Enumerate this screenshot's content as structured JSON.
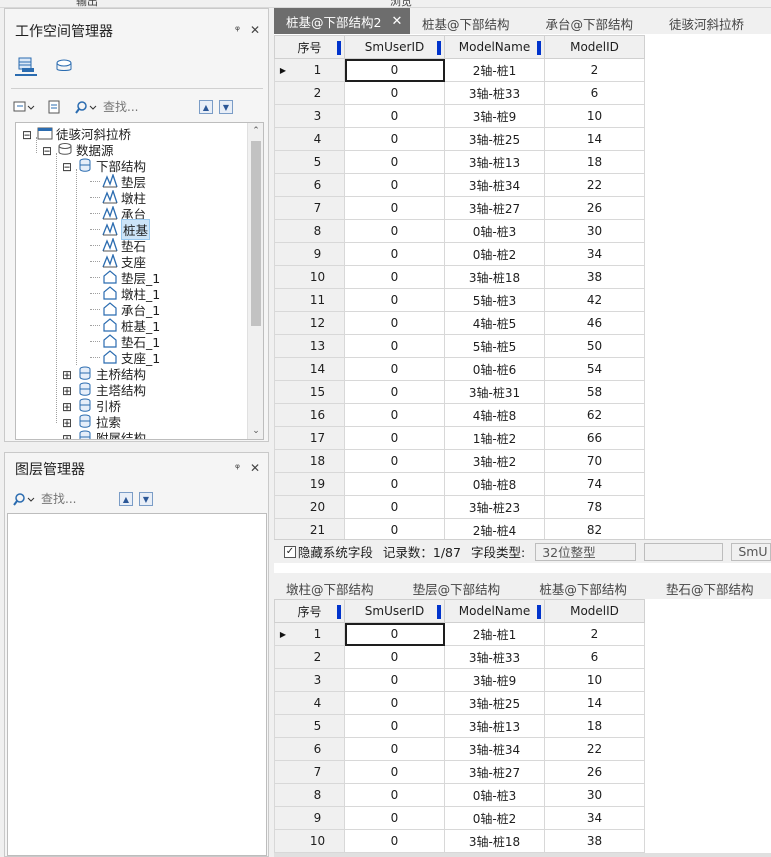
{
  "top": {
    "left_label": "输出",
    "mid_label": "浏览"
  },
  "workspace_panel": {
    "title": "工作空间管理器",
    "pin": "ᵠ",
    "close": "✕",
    "search_placeholder": "查找...",
    "tree": [
      {
        "label": "徒骇河斜拉桥",
        "level": 0,
        "expander": "⊟",
        "icon": "workspace"
      },
      {
        "label": "数据源",
        "level": 1,
        "expander": "⊟",
        "icon": "datasources"
      },
      {
        "label": "下部结构",
        "level": 2,
        "expander": "⊟",
        "icon": "datasource"
      },
      {
        "label": "垫层",
        "level": 3,
        "icon": "model"
      },
      {
        "label": "墩柱",
        "level": 3,
        "icon": "model"
      },
      {
        "label": "承台",
        "level": 3,
        "icon": "model"
      },
      {
        "label": "桩基",
        "level": 3,
        "icon": "model",
        "selected": true
      },
      {
        "label": "垫石",
        "level": 3,
        "icon": "model"
      },
      {
        "label": "支座",
        "level": 3,
        "icon": "model"
      },
      {
        "label": "垫层_1",
        "level": 3,
        "icon": "region"
      },
      {
        "label": "墩柱_1",
        "level": 3,
        "icon": "region"
      },
      {
        "label": "承台_1",
        "level": 3,
        "icon": "region"
      },
      {
        "label": "桩基_1",
        "level": 3,
        "icon": "region"
      },
      {
        "label": "垫石_1",
        "level": 3,
        "icon": "region"
      },
      {
        "label": "支座_1",
        "level": 3,
        "icon": "region"
      },
      {
        "label": "主桥结构",
        "level": 2,
        "expander": "⊞",
        "icon": "datasource"
      },
      {
        "label": "主塔结构",
        "level": 2,
        "expander": "⊞",
        "icon": "datasource"
      },
      {
        "label": "引桥",
        "level": 2,
        "expander": "⊞",
        "icon": "datasource"
      },
      {
        "label": "拉索",
        "level": 2,
        "expander": "⊞",
        "icon": "datasource"
      },
      {
        "label": "附属结构",
        "level": 2,
        "expander": "⊞",
        "icon": "datasource"
      }
    ]
  },
  "layer_panel": {
    "title": "图层管理器",
    "pin": "ᵠ",
    "close": "✕",
    "search_placeholder": "查找..."
  },
  "top_tabs": [
    {
      "label": "桩基@下部结构2",
      "active": true,
      "close": "✕"
    },
    {
      "label": "桩基@下部结构"
    },
    {
      "label": "承台@下部结构"
    },
    {
      "label": "徒骇河斜拉桥"
    }
  ],
  "bottom_tabs": [
    {
      "label": "墩柱@下部结构"
    },
    {
      "label": "垫层@下部结构"
    },
    {
      "label": "桩基@下部结构"
    },
    {
      "label": "垫石@下部结构"
    }
  ],
  "columns": [
    "序号",
    "SmUserID",
    "ModelName",
    "ModelID"
  ],
  "top_rows": [
    [
      "1",
      "0",
      "2轴-桩1",
      "2"
    ],
    [
      "2",
      "0",
      "3轴-桩33",
      "6"
    ],
    [
      "3",
      "0",
      "3轴-桩9",
      "10"
    ],
    [
      "4",
      "0",
      "3轴-桩25",
      "14"
    ],
    [
      "5",
      "0",
      "3轴-桩13",
      "18"
    ],
    [
      "6",
      "0",
      "3轴-桩34",
      "22"
    ],
    [
      "7",
      "0",
      "3轴-桩27",
      "26"
    ],
    [
      "8",
      "0",
      "0轴-桩3",
      "30"
    ],
    [
      "9",
      "0",
      "0轴-桩2",
      "34"
    ],
    [
      "10",
      "0",
      "3轴-桩18",
      "38"
    ],
    [
      "11",
      "0",
      "5轴-桩3",
      "42"
    ],
    [
      "12",
      "0",
      "4轴-桩5",
      "46"
    ],
    [
      "13",
      "0",
      "5轴-桩5",
      "50"
    ],
    [
      "14",
      "0",
      "0轴-桩6",
      "54"
    ],
    [
      "15",
      "0",
      "3轴-桩31",
      "58"
    ],
    [
      "16",
      "0",
      "4轴-桩8",
      "62"
    ],
    [
      "17",
      "0",
      "1轴-桩2",
      "66"
    ],
    [
      "18",
      "0",
      "3轴-桩2",
      "70"
    ],
    [
      "19",
      "0",
      "0轴-桩8",
      "74"
    ],
    [
      "20",
      "0",
      "3轴-桩23",
      "78"
    ],
    [
      "21",
      "0",
      "2轴-桩4",
      "82"
    ]
  ],
  "bottom_rows": [
    [
      "1",
      "0",
      "2轴-桩1",
      "2"
    ],
    [
      "2",
      "0",
      "3轴-桩33",
      "6"
    ],
    [
      "3",
      "0",
      "3轴-桩9",
      "10"
    ],
    [
      "4",
      "0",
      "3轴-桩25",
      "14"
    ],
    [
      "5",
      "0",
      "3轴-桩13",
      "18"
    ],
    [
      "6",
      "0",
      "3轴-桩34",
      "22"
    ],
    [
      "7",
      "0",
      "3轴-桩27",
      "26"
    ],
    [
      "8",
      "0",
      "0轴-桩3",
      "30"
    ],
    [
      "9",
      "0",
      "0轴-桩2",
      "34"
    ],
    [
      "10",
      "0",
      "3轴-桩18",
      "38"
    ]
  ],
  "status": {
    "hide_system_fields": "隐藏系统字段",
    "checkbox": "✓",
    "record_count": "记录数：1/87",
    "field_type_label": "字段类型:",
    "field_type_value": "32位整型",
    "field_name_value": "SmU"
  },
  "colors": {
    "active_tab": "#6d6d6d",
    "column_marker": "#0033cc",
    "selection": "#cce4f7"
  }
}
